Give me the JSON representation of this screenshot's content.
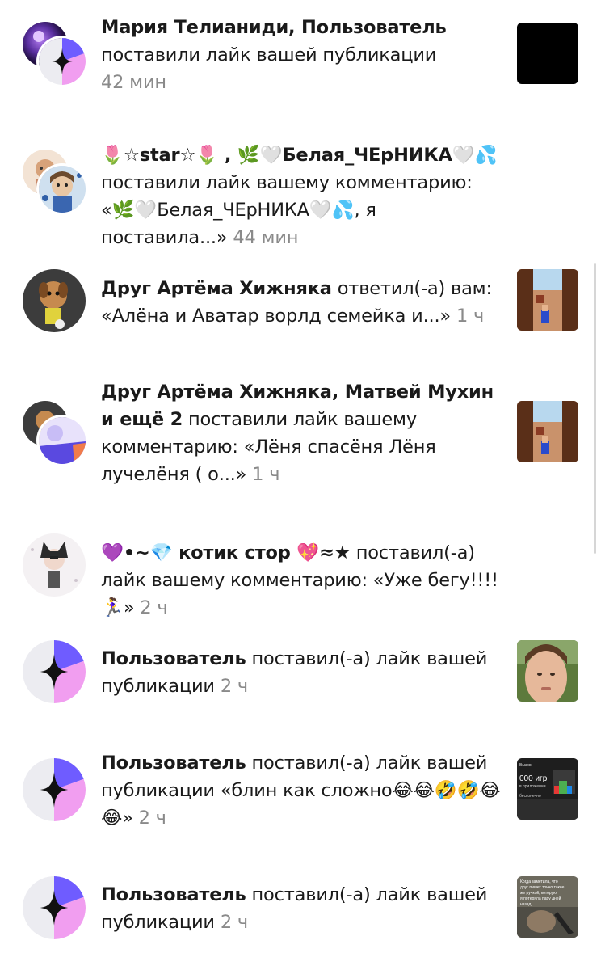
{
  "notifications": [
    {
      "user": "Мария Телианиди, Пользователь",
      "action": "поставили лайк вашей публикации",
      "time": "42 мин"
    },
    {
      "user": "🌷☆star☆🌷 , 🌿🤍Белая_ЧЕрНИКА🤍💦",
      "action": "поставили лайк вашему комментарию: «🌿🤍Белая_ЧЕрНИКА🤍💦, я поставила...»",
      "time": "44 мин"
    },
    {
      "user": "Друг Артёма Хижняка",
      "action": "ответил(-а) вам: «Алёна и Аватар ворлд семейка и...»",
      "time": "1 ч"
    },
    {
      "user": "Друг Артёма Хижняка, Матвей Мухин и ещё 2",
      "action": "поставили лайк вашему комментарию: «Лёня спасёня Лёня лучелёня ( о...»",
      "time": "1 ч"
    },
    {
      "user": "💜•~💎 котик стор 💖≈★",
      "action": "поставил(-а) лайк вашему комментарию: «Уже бегу!!!!🏃‍♀️»",
      "time": "2 ч"
    },
    {
      "user": "Пользователь",
      "action": "поставил(-а) лайк вашей публикации",
      "time": "2 ч"
    },
    {
      "user": "Пользователь",
      "action": "поставил(-а) лайк вашей публикации «блин как сложно😂😂🤣🤣😂😂»",
      "time": "2 ч"
    },
    {
      "user": "Пользователь",
      "action": "поставил(-а) лайк вашей публикации",
      "time": "2 ч"
    }
  ],
  "thumbnails": {
    "t7_text": [
      "Вызов",
      "000 игр",
      "в приложении",
      "бесконечно"
    ],
    "t8_text": [
      "Когда заметила, что",
      "друг пишет точно такие",
      "же ручкой, которую",
      "я потеряла пару дней",
      "назад"
    ]
  },
  "colors": {
    "time": "#8a8a8a",
    "text": "#1a1a1a",
    "default_avatar_bg": "#ececf1",
    "default_avatar_blue": "#6f5cff",
    "default_avatar_pink": "#f19ef0"
  }
}
